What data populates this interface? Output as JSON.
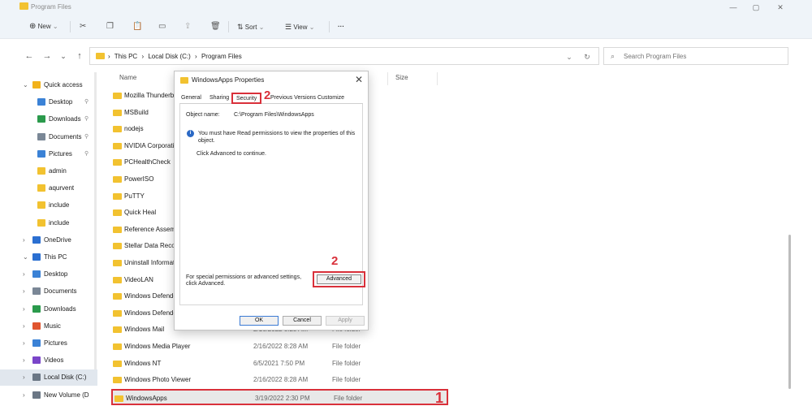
{
  "window": {
    "title": "Program Files",
    "controls": {
      "minimize": "—",
      "maximize": "▢",
      "close": "✕"
    }
  },
  "commandbar": {
    "new_label": "New",
    "sort_label": "Sort",
    "view_label": "View",
    "more_label": "···",
    "chevron": "⌄"
  },
  "address": {
    "back": "←",
    "forward": "→",
    "dropdown": "⌄",
    "up": "↑",
    "crumbs": [
      "This PC",
      "Local Disk (C:)",
      "Program Files"
    ],
    "crumb_sep": "›",
    "dropdown_icon": "⌄",
    "refresh_icon": "↻",
    "search_placeholder": "Search Program Files"
  },
  "nav": {
    "items": [
      {
        "label": "Quick access",
        "icon_color": "#f2b21b",
        "chevron": "⌄",
        "pinned": false
      },
      {
        "label": "Desktop",
        "icon_color": "#3b82d6",
        "pinned": true
      },
      {
        "label": "Downloads",
        "icon_color": "#2b9a4c",
        "pinned": true
      },
      {
        "label": "Documents",
        "icon_color": "#7a8796",
        "pinned": true
      },
      {
        "label": "Pictures",
        "icon_color": "#3b82d6",
        "pinned": true
      },
      {
        "label": "admin",
        "icon_color": "#f2c230",
        "pinned": false
      },
      {
        "label": "aqurvent",
        "icon_color": "#f2c230",
        "pinned": false
      },
      {
        "label": "include",
        "icon_color": "#f2c230",
        "pinned": false
      },
      {
        "label": "include",
        "icon_color": "#f2c230",
        "pinned": false
      },
      {
        "label": "OneDrive",
        "icon_color": "#2b6fd1",
        "chevron": "›",
        "pinned": false
      },
      {
        "label": "This PC",
        "icon_color": "#2b6fd1",
        "chevron": "⌄",
        "pinned": false
      },
      {
        "label": "Desktop",
        "icon_color": "#3b82d6",
        "chevron": "›",
        "pinned": false
      },
      {
        "label": "Documents",
        "icon_color": "#7a8796",
        "chevron": "›",
        "pinned": false
      },
      {
        "label": "Downloads",
        "icon_color": "#2b9a4c",
        "chevron": "›",
        "pinned": false
      },
      {
        "label": "Music",
        "icon_color": "#e0552f",
        "chevron": "›",
        "pinned": false
      },
      {
        "label": "Pictures",
        "icon_color": "#3b82d6",
        "chevron": "›",
        "pinned": false
      },
      {
        "label": "Videos",
        "icon_color": "#7a45c9",
        "chevron": "›",
        "pinned": false
      },
      {
        "label": "Local Disk (C:)",
        "icon_color": "#6b7785",
        "chevron": "›",
        "pinned": false,
        "selected": true
      },
      {
        "label": "New Volume (D",
        "icon_color": "#6b7785",
        "chevron": "›",
        "pinned": false
      }
    ],
    "pin_icon": "📌"
  },
  "filelist": {
    "columns": {
      "name": "Name",
      "size": "Size"
    },
    "rows": [
      {
        "name": "Mozilla Thunderbird",
        "date": "",
        "type": ""
      },
      {
        "name": "MSBuild",
        "date": "",
        "type": ""
      },
      {
        "name": "nodejs",
        "date": "",
        "type": ""
      },
      {
        "name": "NVIDIA Corporation",
        "date": "",
        "type": ""
      },
      {
        "name": "PCHealthCheck",
        "date": "",
        "type": ""
      },
      {
        "name": "PowerISO",
        "date": "",
        "type": ""
      },
      {
        "name": "PuTTY",
        "date": "",
        "type": ""
      },
      {
        "name": "Quick Heal",
        "date": "",
        "type": ""
      },
      {
        "name": "Reference Assemblies",
        "date": "",
        "type": ""
      },
      {
        "name": "Stellar Data Recovery",
        "date": "",
        "type": ""
      },
      {
        "name": "Uninstall Information",
        "date": "",
        "type": ""
      },
      {
        "name": "VideoLAN",
        "date": "",
        "type": ""
      },
      {
        "name": "Windows Defender",
        "date": "",
        "type": ""
      },
      {
        "name": "Windows Defender",
        "date": "",
        "type": ""
      },
      {
        "name": "Windows Mail",
        "date": "2/16/2022 8:28 AM",
        "type": "File folder"
      },
      {
        "name": "Windows Media Player",
        "date": "2/16/2022 8:28 AM",
        "type": "File folder"
      },
      {
        "name": "Windows NT",
        "date": "6/5/2021 7:50 PM",
        "type": "File folder"
      },
      {
        "name": "Windows Photo Viewer",
        "date": "2/16/2022 8:28 AM",
        "type": "File folder"
      },
      {
        "name": "WindowsApps",
        "date": "3/19/2022 2:30 PM",
        "type": "File folder",
        "highlight": true
      }
    ]
  },
  "callouts": {
    "step1": "1",
    "step2_tab": "2",
    "step2_button": "2"
  },
  "dialog": {
    "title": "WindowsApps Properties",
    "close": "✕",
    "tabs": [
      "General",
      "Sharing",
      "Security",
      "Previous Versions",
      "Customize"
    ],
    "active_tab": "Security",
    "object_name_label": "Object name:",
    "object_name_value": "C:\\Program Files\\WindowsApps",
    "info_icon": "i",
    "info_text": "You must have Read permissions to view the properties of this object.",
    "continue_text": "Click Advanced to continue.",
    "special_text": "For special permissions or advanced settings, click Advanced.",
    "advanced_label": "Advanced",
    "ok_label": "OK",
    "cancel_label": "Cancel",
    "apply_label": "Apply"
  }
}
